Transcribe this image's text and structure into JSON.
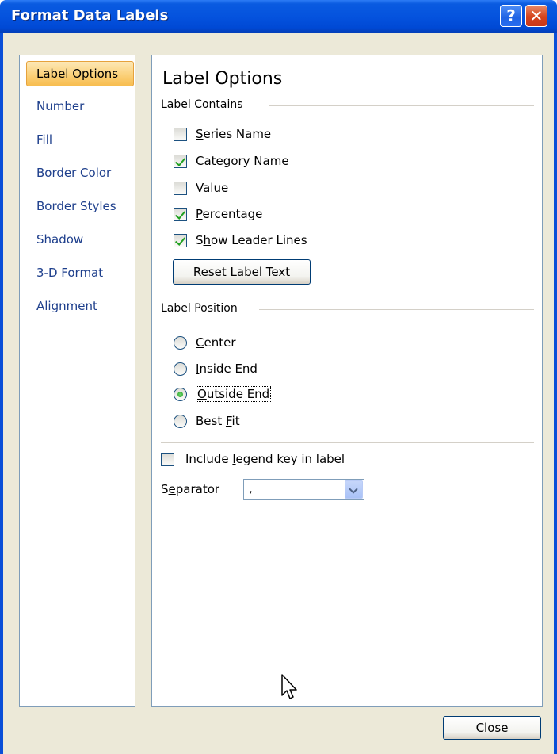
{
  "window": {
    "title": "Format Data Labels",
    "help_glyph": "?",
    "close_glyph": "✕",
    "title_bar_color": "#0553de"
  },
  "nav": {
    "items": [
      {
        "label": "Label Options",
        "selected": true
      },
      {
        "label": "Number"
      },
      {
        "label": "Fill"
      },
      {
        "label": "Border Color"
      },
      {
        "label": "Border Styles"
      },
      {
        "label": "Shadow"
      },
      {
        "label": "3-D Format"
      },
      {
        "label": "Alignment"
      }
    ]
  },
  "panel": {
    "title": "Label Options",
    "label_contains": {
      "heading": "Label Contains",
      "options": [
        {
          "pre": "",
          "key": "S",
          "post": "eries Name",
          "checked": false
        },
        {
          "pre": "Cate",
          "key": "g",
          "post": "ory Name",
          "checked": true
        },
        {
          "pre": "",
          "key": "V",
          "post": "alue",
          "checked": false
        },
        {
          "pre": "",
          "key": "P",
          "post": "ercentage",
          "checked": true
        },
        {
          "pre": "S",
          "key": "h",
          "post": "ow Leader Lines",
          "checked": true
        }
      ],
      "reset_button": {
        "pre": "",
        "key": "R",
        "post": "eset Label Text"
      }
    },
    "label_position": {
      "heading": "Label Position",
      "options": [
        {
          "pre": "",
          "key": "C",
          "post": "enter",
          "selected": false
        },
        {
          "pre": "",
          "key": "I",
          "post": "nside End",
          "selected": false
        },
        {
          "pre": "",
          "key": "O",
          "post": "utside End",
          "selected": true
        },
        {
          "pre": "Best ",
          "key": "F",
          "post": "it",
          "selected": false
        }
      ]
    },
    "legend_key": {
      "pre": "Include ",
      "key": "l",
      "post": "egend key in label",
      "checked": false
    },
    "separator": {
      "pre": "S",
      "key": "e",
      "post": "parator",
      "value": ","
    }
  },
  "footer": {
    "close_label": "Close"
  },
  "colors": {
    "accent_check": "#21a121",
    "nav_text": "#1e3f8c",
    "selected_nav": "#fbd17a"
  }
}
